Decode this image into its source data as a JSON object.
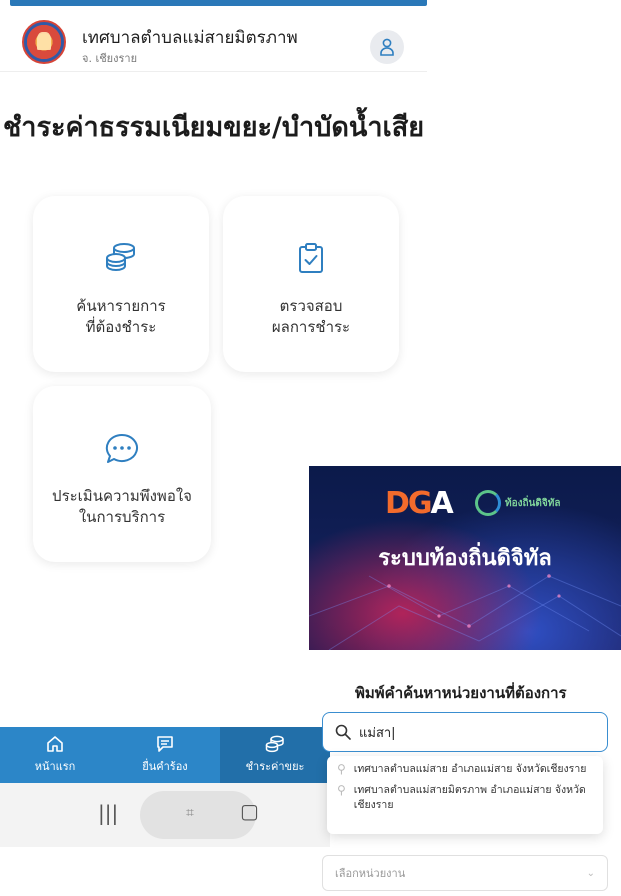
{
  "header": {
    "org_name": "เทศบาลตำบลแม่สายมิตรภาพ",
    "org_sub": "จ. เชียงราย"
  },
  "page_title": "ชำระค่าธรรมเนียมขยะ/บำบัดน้ำเสีย",
  "cards": [
    {
      "label": "ค้นหารายการ\nที่ต้องชำระ",
      "icon": "coins-stack-icon"
    },
    {
      "label": "ตรวจสอบ\nผลการชำระ",
      "icon": "clipboard-check-icon"
    },
    {
      "label": "ประเมินความพึงพอใจ\nในการบริการ",
      "icon": "chat-bubble-icon"
    }
  ],
  "bottom_nav": [
    {
      "label": "หน้าแรก",
      "icon": "home-icon",
      "active": false
    },
    {
      "label": "ยื่นคำร้อง",
      "icon": "message-icon",
      "active": false
    },
    {
      "label": "ชำระค่าขยะ",
      "icon": "coins-icon",
      "active": true
    }
  ],
  "banner": {
    "logo_text_1": "DG",
    "logo_text_2": "A",
    "local_logo_text": "ท้องถิ่นดิจิทัล",
    "title": "ระบบท้องถิ่นดิจิทัล"
  },
  "search": {
    "heading": "พิมพ์คำค้นหาหน่วยงานที่ต้องการ",
    "value": "แม่สา|",
    "suggestions": [
      "เทศบาลตำบลแม่สาย อำเภอแม่สาย จังหวัดเชียงราย",
      "เทศบาลตำบลแม่สายมิตรภาพ อำเภอแม่สาย จังหวัดเชียงราย"
    ],
    "select_placeholder": "เลือกหน่วยงาน"
  },
  "colors": {
    "accent": "#2c86c8",
    "accent_dark": "#226fa9",
    "icon_blue": "#2f7fc0"
  }
}
